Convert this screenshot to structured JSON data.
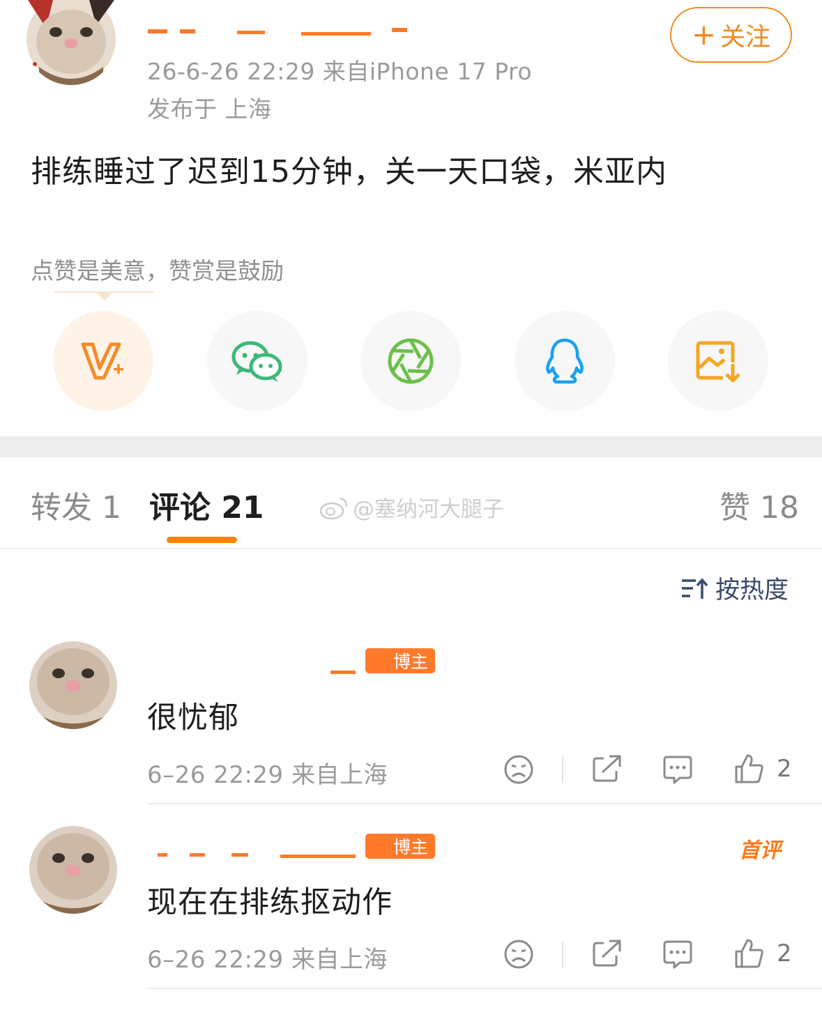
{
  "post": {
    "meta_line": "26-6-26 22:29  来自iPhone 17 Pro",
    "location": "发布于 上海",
    "follow_label": "关注",
    "follow_plus": "+",
    "text": "排练睡过了迟到15分钟，关一天口袋，米亚内"
  },
  "reward": {
    "tip": "点赞是美意，赞赏是鼓励"
  },
  "share_targets": [
    {
      "icon": "weibo-reward-v-plus-icon",
      "color": "#f28c28"
    },
    {
      "icon": "wechat-icon",
      "color": "#3cb878"
    },
    {
      "icon": "moments-aperture-icon",
      "color": "#6cc04a"
    },
    {
      "icon": "qq-penguin-icon",
      "color": "#1aa0f0"
    },
    {
      "icon": "save-image-icon",
      "color": "#f5a623"
    }
  ],
  "tabs": {
    "repost": "转发 1",
    "comments": "评论 21",
    "likes": "赞 18",
    "accent": "#ff8200"
  },
  "watermark": "@塞纳河大腿子",
  "sort": {
    "label": "按热度"
  },
  "comments": [
    {
      "badge": "博主",
      "text": "很忧郁",
      "meta": "6–26 22:29  来自上海",
      "likes": "2"
    },
    {
      "badge": "博主",
      "text": "现在在排练抠动作",
      "meta": "6–26 22:29  来自上海",
      "likes": "2",
      "tag": "首评"
    }
  ]
}
